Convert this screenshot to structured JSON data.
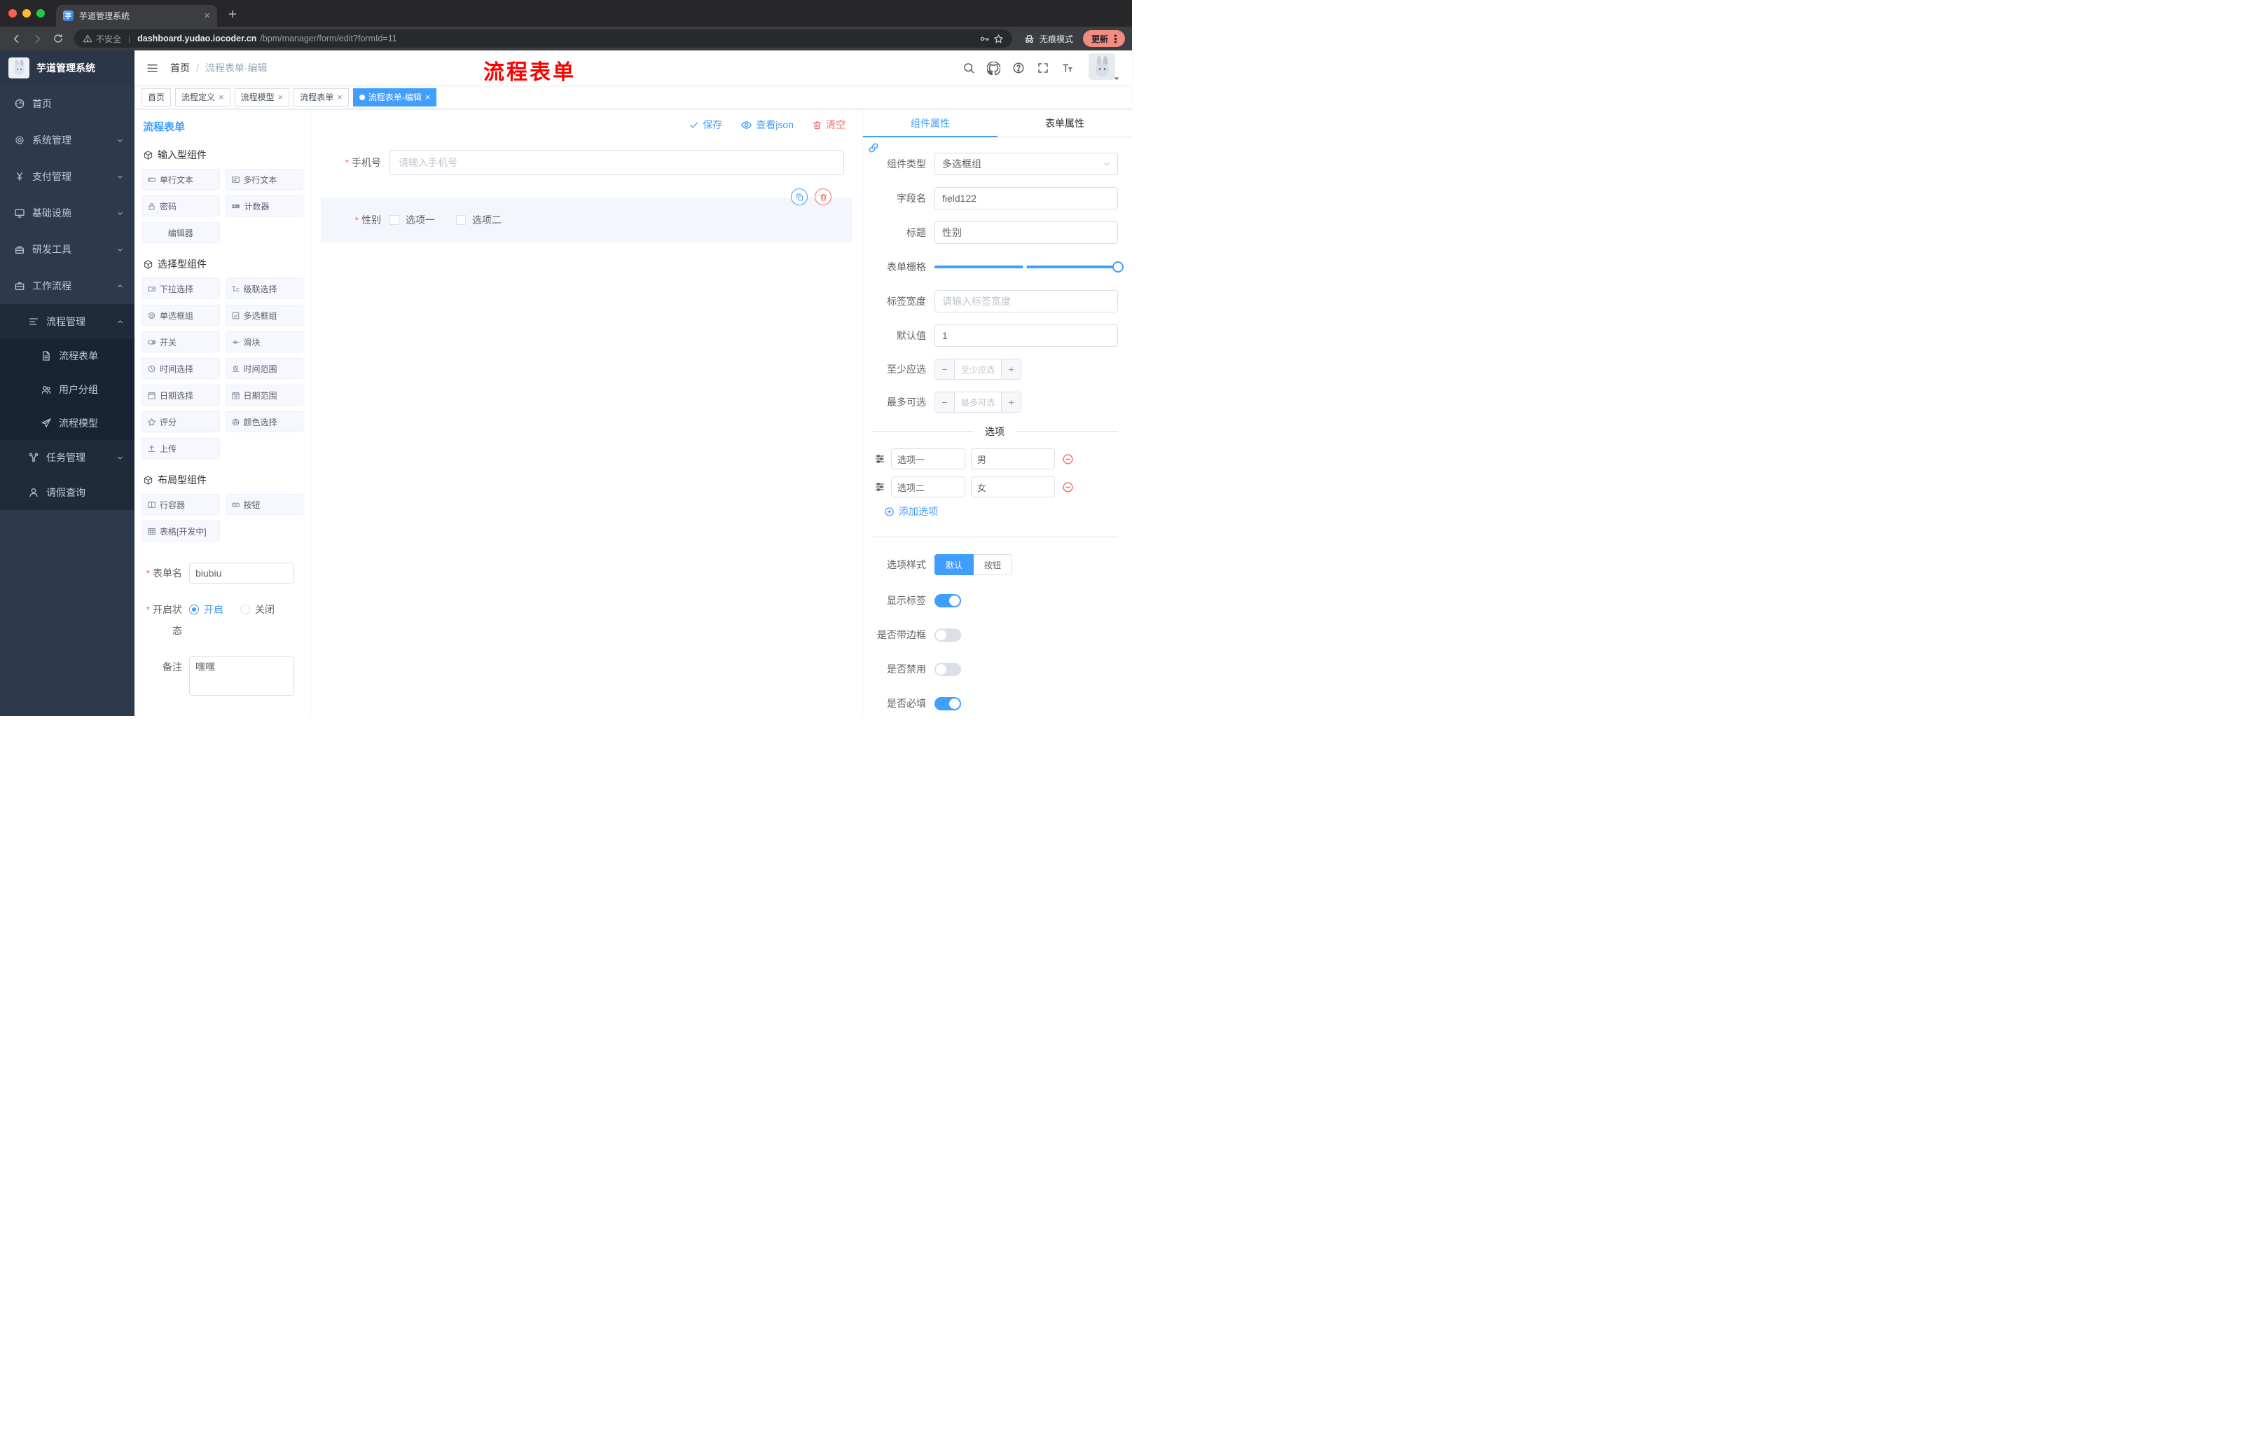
{
  "browser": {
    "tab_title": "芋道管理系统",
    "security_label": "不安全",
    "url_host": "dashboard.yudao.iocoder.cn",
    "url_path": "/bpm/manager/form/edit?formId=11",
    "incognito_label": "无痕模式",
    "update_label": "更新"
  },
  "sidebar": {
    "logo_title": "芋道管理系统",
    "items": [
      {
        "label": "首页"
      },
      {
        "label": "系统管理"
      },
      {
        "label": "支付管理"
      },
      {
        "label": "基础设施"
      },
      {
        "label": "研发工具"
      },
      {
        "label": "工作流程"
      },
      {
        "label": "流程管理"
      },
      {
        "label": "流程表单"
      },
      {
        "label": "用户分组"
      },
      {
        "label": "流程模型"
      },
      {
        "label": "任务管理"
      },
      {
        "label": "请假查询"
      }
    ]
  },
  "header": {
    "breadcrumb_home": "首页",
    "breadcrumb_current": "流程表单-编辑",
    "annotation": "流程表单"
  },
  "tags": [
    {
      "label": "首页"
    },
    {
      "label": "流程定义"
    },
    {
      "label": "流程模型"
    },
    {
      "label": "流程表单"
    },
    {
      "label": "流程表单-编辑"
    }
  ],
  "palette": {
    "title": "流程表单",
    "groups": [
      {
        "title": "输入型组件",
        "items": [
          {
            "label": "单行文本"
          },
          {
            "label": "多行文本"
          },
          {
            "label": "密码"
          },
          {
            "label": "计数器"
          },
          {
            "label": "编辑器"
          }
        ]
      },
      {
        "title": "选择型组件",
        "items": [
          {
            "label": "下拉选择"
          },
          {
            "label": "级联选择"
          },
          {
            "label": "单选框组"
          },
          {
            "label": "多选框组"
          },
          {
            "label": "开关"
          },
          {
            "label": "滑块"
          },
          {
            "label": "时间选择"
          },
          {
            "label": "时间范围"
          },
          {
            "label": "日期选择"
          },
          {
            "label": "日期范围"
          },
          {
            "label": "评分"
          },
          {
            "label": "颜色选择"
          },
          {
            "label": "上传"
          }
        ]
      },
      {
        "title": "布局型组件",
        "items": [
          {
            "label": "行容器"
          },
          {
            "label": "按钮"
          },
          {
            "label": "表格[开发中]"
          }
        ]
      }
    ],
    "form": {
      "name_label": "表单名",
      "name_value": "biubiu",
      "status_label": "开启状态",
      "status_on": "开启",
      "status_off": "关闭",
      "remark_label": "备注",
      "remark_value": "嘿嘿"
    }
  },
  "canvas": {
    "toolbar": {
      "save": "保存",
      "view_json": "查看json",
      "clear": "清空"
    },
    "phone": {
      "label": "手机号",
      "placeholder": "请输入手机号"
    },
    "gender": {
      "label": "性别",
      "option1": "选项一",
      "option2": "选项二"
    }
  },
  "properties": {
    "tab_component": "组件属性",
    "tab_form": "表单属性",
    "rows": {
      "type_label": "组件类型",
      "type_value": "多选框组",
      "field_label": "字段名",
      "field_value": "field122",
      "title_label": "标题",
      "title_value": "性别",
      "grid_label": "表单栅格",
      "width_label": "标签宽度",
      "width_placeholder": "请输入标签宽度",
      "default_label": "默认值",
      "default_value": "1",
      "min_label": "至少应选",
      "min_placeholder": "至少应选",
      "max_label": "最多可选",
      "max_placeholder": "最多可选"
    },
    "options": {
      "divider": "选项",
      "rows": [
        {
          "label": "选项一",
          "value": "男"
        },
        {
          "label": "选项二",
          "value": "女"
        }
      ],
      "add": "添加选项"
    },
    "style": {
      "label": "选项样式",
      "default": "默认",
      "button": "按钮"
    },
    "toggles": [
      {
        "label": "显示标签",
        "on": true
      },
      {
        "label": "是否带边框",
        "on": false
      },
      {
        "label": "是否禁用",
        "on": false
      },
      {
        "label": "是否必填",
        "on": true
      }
    ]
  },
  "colors": {
    "accent": "#409EFF",
    "danger": "#F56C6C",
    "annotation": "#FF0000",
    "sidebar_bg": "#2D3A4B"
  }
}
